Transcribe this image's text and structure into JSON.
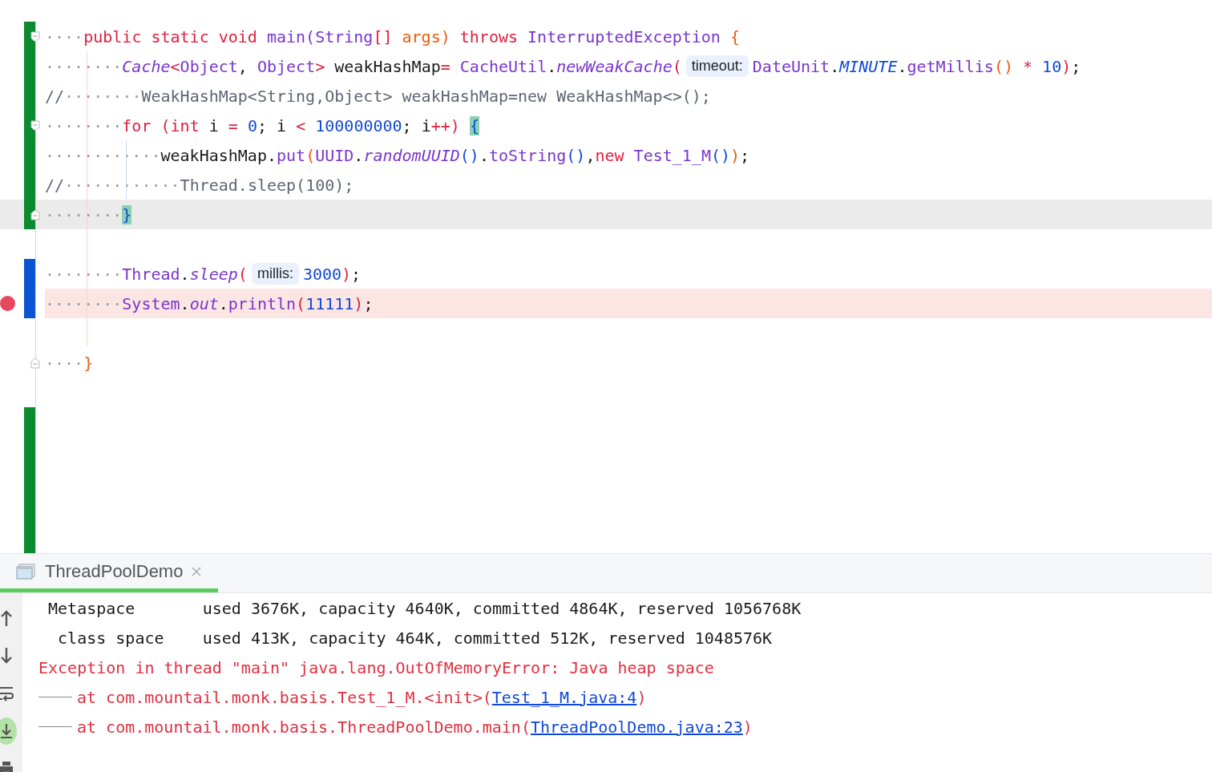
{
  "editor": {
    "lines": [
      {
        "added": true,
        "modified": false,
        "fold_start": true,
        "fold_end": false,
        "current": false,
        "breakpoint": false,
        "tokens": [
          {
            "text": "····",
            "kind": "ws"
          },
          {
            "text": "public static void ",
            "kind": "kw"
          },
          {
            "text": "main(String",
            "kind": "typ"
          },
          {
            "text": "[] ",
            "kind": "op"
          },
          {
            "text": "args) ",
            "kind": "par"
          },
          {
            "text": "throws ",
            "kind": "kw"
          },
          {
            "text": "InterruptedException ",
            "kind": "typ"
          },
          {
            "text": "{",
            "kind": "par"
          }
        ]
      },
      {
        "added": true,
        "modified": false,
        "fold_start": false,
        "fold_end": false,
        "current": false,
        "breakpoint": false,
        "tokens": [
          {
            "text": "········",
            "kind": "ws"
          },
          {
            "text": "Cache",
            "kind": "it"
          },
          {
            "text": "<",
            "kind": "op"
          },
          {
            "text": "Object",
            "kind": "typ"
          },
          {
            "text": ", ",
            "kind": "plain"
          },
          {
            "text": "Object",
            "kind": "typ"
          },
          {
            "text": ">",
            "kind": "op"
          },
          {
            "text": " weakHashMap",
            "kind": "plain"
          },
          {
            "text": "= ",
            "kind": "op"
          },
          {
            "text": "CacheUtil",
            "kind": "typ"
          },
          {
            "text": ".",
            "kind": "plain"
          },
          {
            "text": "newWeakCache",
            "kind": "it"
          },
          {
            "text": "(",
            "kind": "op"
          },
          {
            "text": "timeout:",
            "kind": "hint"
          },
          {
            "text": "DateUnit",
            "kind": "typ"
          },
          {
            "text": ".",
            "kind": "plain"
          },
          {
            "text": "MINUTE",
            "kind": "const"
          },
          {
            "text": ".",
            "kind": "plain"
          },
          {
            "text": "getMillis",
            "kind": "typ"
          },
          {
            "text": "()",
            "kind": "par"
          },
          {
            "text": " * ",
            "kind": "op"
          },
          {
            "text": "10",
            "kind": "num"
          },
          {
            "text": ")",
            "kind": "op"
          },
          {
            "text": ";",
            "kind": "plain"
          }
        ]
      },
      {
        "added": true,
        "modified": false,
        "fold_start": false,
        "fold_end": false,
        "current": false,
        "breakpoint": false,
        "tokens": [
          {
            "text": "//",
            "kind": "com"
          },
          {
            "text": "········",
            "kind": "ws"
          },
          {
            "text": "WeakHashMap<String,Object> weakHashMap=new WeakHashMap<>();",
            "kind": "com"
          }
        ]
      },
      {
        "added": true,
        "modified": false,
        "fold_start": true,
        "fold_end": false,
        "current": false,
        "breakpoint": false,
        "tokens": [
          {
            "text": "········",
            "kind": "ws"
          },
          {
            "text": "for ",
            "kind": "kw"
          },
          {
            "text": "(",
            "kind": "op"
          },
          {
            "text": "int ",
            "kind": "kw"
          },
          {
            "text": "i ",
            "kind": "plain"
          },
          {
            "text": "= ",
            "kind": "op"
          },
          {
            "text": "0",
            "kind": "num"
          },
          {
            "text": "; i ",
            "kind": "plain"
          },
          {
            "text": "< ",
            "kind": "op"
          },
          {
            "text": "100000000",
            "kind": "num"
          },
          {
            "text": "; i",
            "kind": "plain"
          },
          {
            "text": "++) ",
            "kind": "op"
          },
          {
            "text": "{",
            "kind": "match"
          }
        ]
      },
      {
        "added": true,
        "modified": false,
        "fold_start": false,
        "fold_end": false,
        "current": false,
        "breakpoint": false,
        "tokens": [
          {
            "text": "············",
            "kind": "ws"
          },
          {
            "text": "weakHashMap.",
            "kind": "plain"
          },
          {
            "text": "put",
            "kind": "typ"
          },
          {
            "text": "(",
            "kind": "par"
          },
          {
            "text": "UUID",
            "kind": "typ"
          },
          {
            "text": ".",
            "kind": "plain"
          },
          {
            "text": "randomUUID",
            "kind": "it"
          },
          {
            "text": "()",
            "kind": "num"
          },
          {
            "text": ".",
            "kind": "plain"
          },
          {
            "text": "toString",
            "kind": "typ"
          },
          {
            "text": "()",
            "kind": "num"
          },
          {
            "text": ",",
            "kind": "plain"
          },
          {
            "text": "new ",
            "kind": "kw"
          },
          {
            "text": "Test_1_M",
            "kind": "typ"
          },
          {
            "text": "()",
            "kind": "num"
          },
          {
            "text": ")",
            "kind": "par"
          },
          {
            "text": ";",
            "kind": "plain"
          }
        ]
      },
      {
        "added": true,
        "modified": false,
        "fold_start": false,
        "fold_end": false,
        "current": false,
        "breakpoint": false,
        "tokens": [
          {
            "text": "//",
            "kind": "com"
          },
          {
            "text": "············",
            "kind": "ws"
          },
          {
            "text": "Thread.sleep(100);",
            "kind": "com"
          }
        ]
      },
      {
        "added": true,
        "modified": false,
        "fold_start": false,
        "fold_end": true,
        "current": true,
        "breakpoint": false,
        "tokens": [
          {
            "text": "········",
            "kind": "ws"
          },
          {
            "text": "}",
            "kind": "match"
          }
        ]
      },
      {
        "added": false,
        "modified": false,
        "fold_start": false,
        "fold_end": false,
        "current": false,
        "breakpoint": false
      },
      {
        "added": false,
        "modified": true,
        "fold_start": false,
        "fold_end": false,
        "current": false,
        "breakpoint": false,
        "tokens": [
          {
            "text": "········",
            "kind": "ws"
          },
          {
            "text": "Thread",
            "kind": "typ"
          },
          {
            "text": ".",
            "kind": "plain"
          },
          {
            "text": "sleep",
            "kind": "it"
          },
          {
            "text": "(",
            "kind": "op"
          },
          {
            "text": "millis:",
            "kind": "hint"
          },
          {
            "text": "3000",
            "kind": "num"
          },
          {
            "text": ")",
            "kind": "op"
          },
          {
            "text": ";",
            "kind": "plain"
          }
        ]
      },
      {
        "added": false,
        "modified": true,
        "fold_start": false,
        "fold_end": false,
        "current": false,
        "breakpoint": true,
        "tokens": [
          {
            "text": "········",
            "kind": "ws"
          },
          {
            "text": "System",
            "kind": "typ"
          },
          {
            "text": ".",
            "kind": "plain"
          },
          {
            "text": "out",
            "kind": "it"
          },
          {
            "text": ".",
            "kind": "plain"
          },
          {
            "text": "println",
            "kind": "typ"
          },
          {
            "text": "(",
            "kind": "op"
          },
          {
            "text": "11111",
            "kind": "num"
          },
          {
            "text": ")",
            "kind": "op"
          },
          {
            "text": ";",
            "kind": "plain"
          }
        ]
      },
      {
        "added": false,
        "modified": false,
        "fold_start": false,
        "fold_end": false,
        "current": false,
        "breakpoint": false
      },
      {
        "added": false,
        "modified": false,
        "fold_start": false,
        "fold_end": true,
        "current": false,
        "breakpoint": false,
        "tokens": [
          {
            "text": "····",
            "kind": "ws"
          },
          {
            "text": "}",
            "kind": "par"
          }
        ]
      },
      {
        "added": false,
        "modified": false,
        "fold_start": false,
        "fold_end": false,
        "current": false,
        "breakpoint": false
      },
      {
        "added": true,
        "modified": false,
        "fold_start": false,
        "fold_end": false,
        "current": false,
        "breakpoint": false
      },
      {
        "added": true,
        "modified": false,
        "fold_start": false,
        "fold_end": false,
        "current": false,
        "breakpoint": false
      },
      {
        "added": true,
        "modified": false,
        "fold_start": false,
        "fold_end": false,
        "current": false,
        "breakpoint": false
      },
      {
        "added": true,
        "modified": false,
        "fold_start": false,
        "fold_end": false,
        "current": false,
        "breakpoint": false
      },
      {
        "added": true,
        "modified": false,
        "fold_start": false,
        "fold_end": false,
        "current": false,
        "breakpoint": false
      }
    ]
  },
  "run_panel": {
    "tabs": [
      {
        "label": "ThreadPoolDemo",
        "selected": true
      }
    ],
    "toolbar": [
      {
        "kind": "up",
        "on": false
      },
      {
        "kind": "down",
        "on": false
      },
      {
        "kind": "wrap",
        "on": false
      },
      {
        "kind": "scroll-end",
        "on": true
      },
      {
        "kind": "print",
        "on": false
      }
    ],
    "console": [
      {
        "kind": "plain",
        "parts": [
          {
            "text": " Metaspace       used 3676K, capacity 4640K, committed 4864K, reserved 1056768K",
            "kind": "plain"
          }
        ]
      },
      {
        "kind": "plain",
        "parts": [
          {
            "text": "  class space    used 413K, capacity 464K, committed 512K, reserved 1048576K",
            "kind": "plain"
          }
        ]
      },
      {
        "kind": "plain",
        "parts": [
          {
            "text": "Exception in thread \"main\" java.lang.OutOfMemoryError: Java heap space",
            "kind": "error"
          }
        ]
      },
      {
        "kind": "stack",
        "parts": [
          {
            "text": "at com.mountail.monk.basis.Test_1_M.<init>(",
            "kind": "error"
          },
          {
            "text": "Test_1_M.java:4",
            "kind": "link"
          },
          {
            "text": ")",
            "kind": "error"
          }
        ]
      },
      {
        "kind": "stack",
        "parts": [
          {
            "text": "at com.mountail.monk.basis.ThreadPoolDemo.main(",
            "kind": "error"
          },
          {
            "text": "ThreadPoolDemo.java:23",
            "kind": "link"
          },
          {
            "text": ")",
            "kind": "error"
          }
        ]
      }
    ]
  }
}
